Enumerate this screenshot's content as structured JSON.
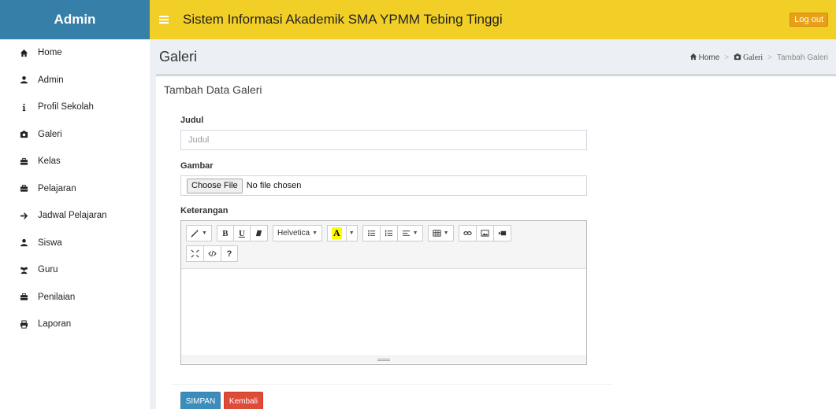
{
  "header": {
    "brand": "Admin",
    "title": "Sistem Informasi Akademik SMA YPMM Tebing Tinggi",
    "logout_label": "Log out"
  },
  "sidebar": {
    "items": [
      {
        "label": "Home",
        "icon": "home-icon"
      },
      {
        "label": "Admin",
        "icon": "user-icon"
      },
      {
        "label": "Profil Sekolah",
        "icon": "info-icon"
      },
      {
        "label": "Galeri",
        "icon": "camera-icon"
      },
      {
        "label": "Kelas",
        "icon": "briefcase-icon"
      },
      {
        "label": "Pelajaran",
        "icon": "briefcase-icon"
      },
      {
        "label": "Jadwal Pelajaran",
        "icon": "arrow-right-icon"
      },
      {
        "label": "Siswa",
        "icon": "user-icon"
      },
      {
        "label": "Guru",
        "icon": "users-icon"
      },
      {
        "label": "Penilaian",
        "icon": "briefcase-icon"
      },
      {
        "label": "Laporan",
        "icon": "print-icon"
      }
    ]
  },
  "page": {
    "title": "Galeri",
    "breadcrumb": [
      "Home",
      "Galeri",
      "Tambah Galeri"
    ]
  },
  "form": {
    "box_title": "Tambah Data Galeri",
    "judul_label": "Judul",
    "judul_placeholder": "Judul",
    "gambar_label": "Gambar",
    "file_button": "Choose File",
    "file_status": "No file chosen",
    "keterangan_label": "Keterangan",
    "editor_font": "Helvetica",
    "editor_color_letter": "A",
    "save_label": "SIMPAN",
    "back_label": "Kembali"
  },
  "colors": {
    "brand_bg": "#367fa9",
    "topbar_bg": "#f2cf26",
    "save_btn": "#3c8dbc",
    "back_btn": "#dd4b39"
  }
}
